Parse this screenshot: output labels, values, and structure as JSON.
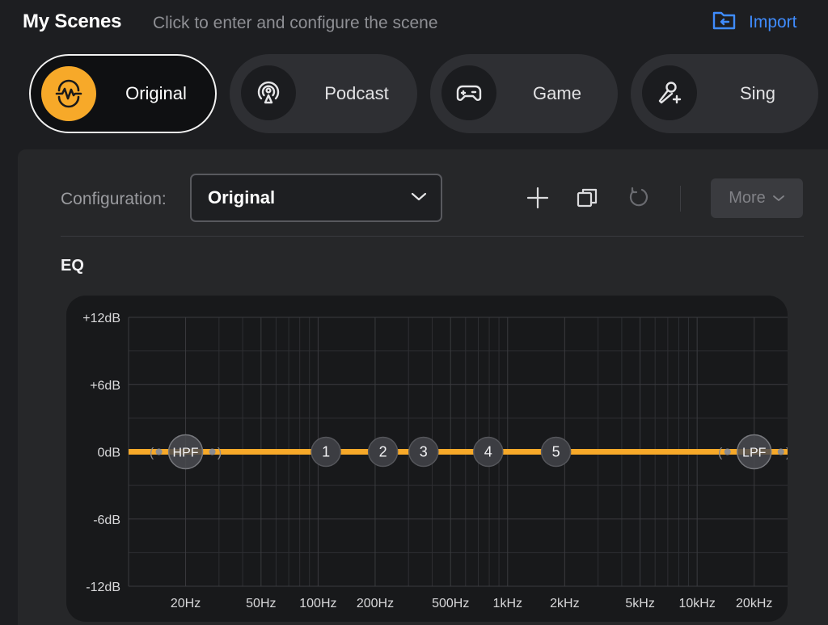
{
  "header": {
    "title": "My Scenes",
    "subtitle": "Click to enter and configure the scene",
    "import_label": "Import"
  },
  "scenes": [
    {
      "label": "Original",
      "icon": "waveform-icon",
      "active": true
    },
    {
      "label": "Podcast",
      "icon": "podcast-icon",
      "active": false
    },
    {
      "label": "Game",
      "icon": "gamepad-icon",
      "active": false
    },
    {
      "label": "Sing",
      "icon": "microphone-sparkle-icon",
      "active": false
    }
  ],
  "config": {
    "label": "Configuration:",
    "value": "Original",
    "more_label": "More"
  },
  "toolbar": {
    "icons": [
      "plus-icon",
      "copy-icon",
      "reset-icon"
    ]
  },
  "eq": {
    "label": "EQ",
    "y_ticks": [
      "+12dB",
      "+6dB",
      "0dB",
      "-6dB",
      "-12dB"
    ],
    "x_ticks": [
      "20Hz",
      "50Hz",
      "100Hz",
      "200Hz",
      "500Hz",
      "1kHz",
      "2kHz",
      "5kHz",
      "10kHz",
      "20kHz"
    ],
    "nodes": [
      {
        "label": "HPF",
        "freq": 20,
        "gain": 0,
        "type": "filter"
      },
      {
        "label": "1",
        "freq": 110,
        "gain": 0,
        "type": "band"
      },
      {
        "label": "2",
        "freq": 220,
        "gain": 0,
        "type": "band"
      },
      {
        "label": "3",
        "freq": 360,
        "gain": 0,
        "type": "band"
      },
      {
        "label": "4",
        "freq": 790,
        "gain": 0,
        "type": "band"
      },
      {
        "label": "5",
        "freq": 1800,
        "gain": 0,
        "type": "band"
      },
      {
        "label": "LPF",
        "freq": 20000,
        "gain": 0,
        "type": "filter"
      }
    ],
    "curve_color": "#f7a929"
  },
  "colors": {
    "accent": "#f7a929",
    "link": "#3f8cff"
  }
}
